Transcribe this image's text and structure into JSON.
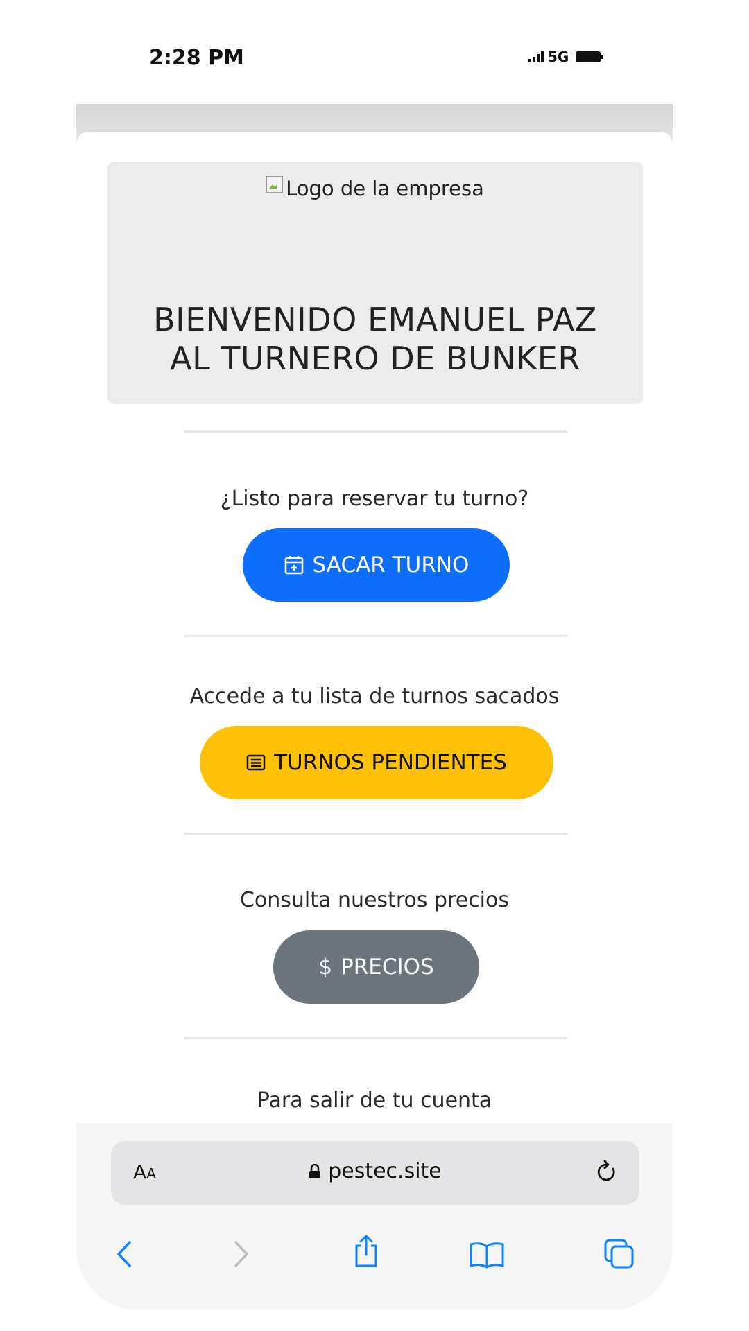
{
  "status_bar": {
    "time": "2:28 PM",
    "network": "5G"
  },
  "hero": {
    "logo_alt": "Logo de la empresa",
    "welcome_line1": "BIENVENIDO EMANUEL PAZ",
    "welcome_line2": "AL TURNERO DE BUNKER"
  },
  "sections": {
    "reserve": {
      "prompt": "¿Listo para reservar tu turno?",
      "button_label": "SACAR TURNO",
      "icon": "calendar-plus-icon",
      "color": "#0d6efd"
    },
    "pending": {
      "prompt": "Accede a tu lista de turnos sacados",
      "button_label": "TURNOS PENDIENTES",
      "icon": "list-card-icon",
      "color": "#ffc107"
    },
    "prices": {
      "prompt": "Consulta nuestros precios",
      "button_label": "PRECIOS",
      "icon": "dollar-icon",
      "color": "#6c757d"
    },
    "logout": {
      "prompt": "Para salir de tu cuenta",
      "color": "#dc3545"
    }
  },
  "browser": {
    "text_size_big": "A",
    "text_size_small": "A",
    "domain": "pestec.site",
    "icons": [
      "lock-icon",
      "reload-icon",
      "back-icon",
      "forward-icon",
      "share-icon",
      "bookmarks-icon",
      "tabs-icon"
    ],
    "accent": "#0a84ff"
  }
}
